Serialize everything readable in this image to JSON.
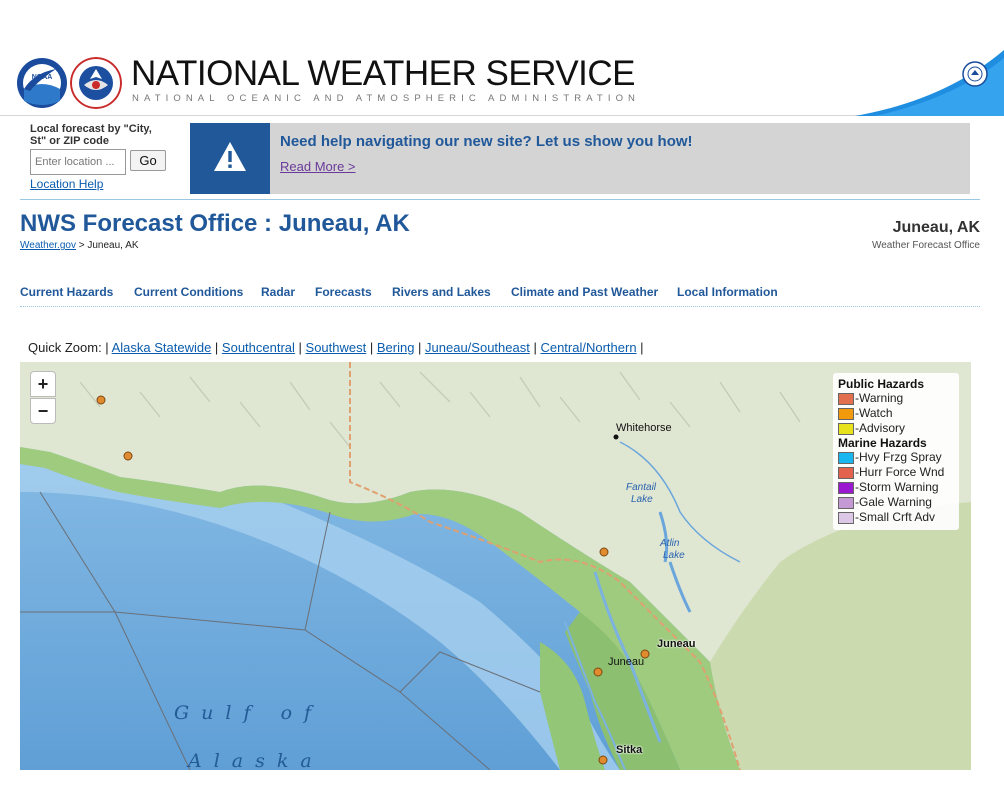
{
  "header": {
    "title": "NATIONAL WEATHER SERVICE",
    "subtitle": "NATIONAL OCEANIC AND ATMOSPHERIC ADMINISTRATION",
    "logos": [
      "noaa-logo",
      "nws-logo",
      "doc-seal"
    ]
  },
  "local_forecast": {
    "label": "Local forecast by \"City, St\" or ZIP code",
    "input_placeholder": "Enter location ...",
    "input_value": "",
    "go_label": "Go",
    "help_link": "Location Help"
  },
  "notice": {
    "icon": "warning-icon",
    "text": "Need help navigating our new site? Let us show you how!",
    "link": "Read More >"
  },
  "office": {
    "title": "NWS Forecast Office : Juneau, AK",
    "breadcrumb_home": "Weather.gov",
    "breadcrumb_sep": " > ",
    "breadcrumb_current": "Juneau, AK",
    "name": "Juneau, AK",
    "subtitle": "Weather Forecast Office"
  },
  "nav": {
    "items": [
      {
        "label": "Current Hazards"
      },
      {
        "label": "Current Conditions"
      },
      {
        "label": "Radar"
      },
      {
        "label": "Forecasts"
      },
      {
        "label": "Rivers and Lakes"
      },
      {
        "label": "Climate and Past Weather"
      },
      {
        "label": "Local Information"
      }
    ]
  },
  "quick_zoom": {
    "label": "Quick Zoom: ",
    "separator": " | ",
    "links": [
      "Alaska Statewide",
      "Southcentral",
      "Southwest",
      "Bering",
      "Juneau/Southeast",
      "Central/Northern"
    ]
  },
  "map": {
    "zoom_in": "+",
    "zoom_out": "−",
    "labels": {
      "whitehorse": "Whitehorse",
      "fantail_lake_1": "Fantail",
      "fantail_lake_2": "Lake",
      "atlin_lake_1": "Atlin",
      "atlin_lake_2": "Lake",
      "juneau_bold": "Juneau",
      "juneau": "Juneau",
      "sitka": "Sitka",
      "gulf_1": "Gulf of",
      "gulf_2": "Alaska"
    },
    "marker_color": "#e28a2e",
    "legend": {
      "public_heading": "Public Hazards",
      "public": [
        {
          "label": "-Warning",
          "color": "#e2704e"
        },
        {
          "label": "-Watch",
          "color": "#f39a0c"
        },
        {
          "label": "-Advisory",
          "color": "#e7e21b"
        }
      ],
      "marine_heading": "Marine Hazards",
      "marine": [
        {
          "label": "-Hvy Frzg Spray",
          "color": "#19b6ef"
        },
        {
          "label": "-Hurr Force Wnd",
          "color": "#e2624e"
        },
        {
          "label": "-Storm Warning",
          "color": "#9a19d0"
        },
        {
          "label": "-Gale Warning",
          "color": "#c59ad4"
        },
        {
          "label": "-Small Crft Adv",
          "color": "#dcc7e6"
        }
      ]
    }
  }
}
